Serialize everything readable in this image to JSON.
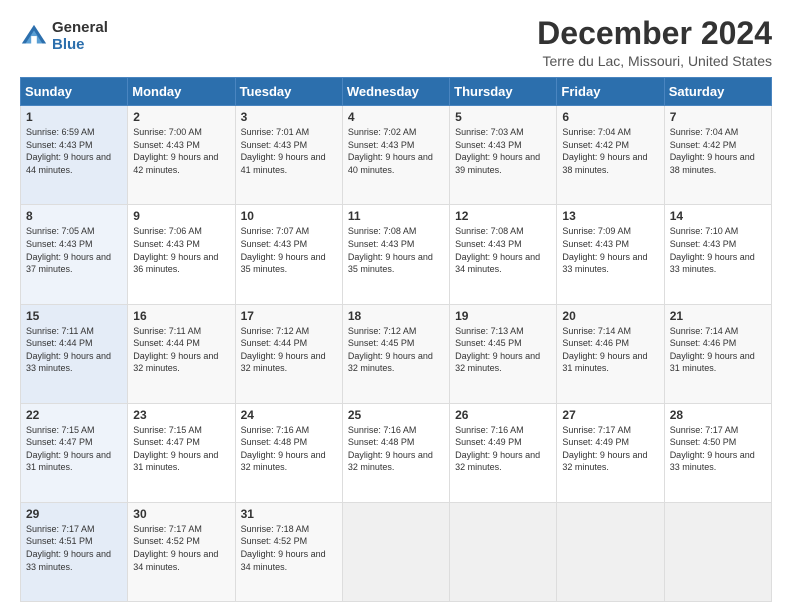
{
  "header": {
    "logo_general": "General",
    "logo_blue": "Blue",
    "title": "December 2024",
    "subtitle": "Terre du Lac, Missouri, United States"
  },
  "days_of_week": [
    "Sunday",
    "Monday",
    "Tuesday",
    "Wednesday",
    "Thursday",
    "Friday",
    "Saturday"
  ],
  "weeks": [
    [
      {
        "day": "1",
        "sunrise": "6:59 AM",
        "sunset": "4:43 PM",
        "daylight": "9 hours and 44 minutes."
      },
      {
        "day": "2",
        "sunrise": "7:00 AM",
        "sunset": "4:43 PM",
        "daylight": "9 hours and 42 minutes."
      },
      {
        "day": "3",
        "sunrise": "7:01 AM",
        "sunset": "4:43 PM",
        "daylight": "9 hours and 41 minutes."
      },
      {
        "day": "4",
        "sunrise": "7:02 AM",
        "sunset": "4:43 PM",
        "daylight": "9 hours and 40 minutes."
      },
      {
        "day": "5",
        "sunrise": "7:03 AM",
        "sunset": "4:43 PM",
        "daylight": "9 hours and 39 minutes."
      },
      {
        "day": "6",
        "sunrise": "7:04 AM",
        "sunset": "4:42 PM",
        "daylight": "9 hours and 38 minutes."
      },
      {
        "day": "7",
        "sunrise": "7:04 AM",
        "sunset": "4:42 PM",
        "daylight": "9 hours and 38 minutes."
      }
    ],
    [
      {
        "day": "8",
        "sunrise": "7:05 AM",
        "sunset": "4:43 PM",
        "daylight": "9 hours and 37 minutes."
      },
      {
        "day": "9",
        "sunrise": "7:06 AM",
        "sunset": "4:43 PM",
        "daylight": "9 hours and 36 minutes."
      },
      {
        "day": "10",
        "sunrise": "7:07 AM",
        "sunset": "4:43 PM",
        "daylight": "9 hours and 35 minutes."
      },
      {
        "day": "11",
        "sunrise": "7:08 AM",
        "sunset": "4:43 PM",
        "daylight": "9 hours and 35 minutes."
      },
      {
        "day": "12",
        "sunrise": "7:08 AM",
        "sunset": "4:43 PM",
        "daylight": "9 hours and 34 minutes."
      },
      {
        "day": "13",
        "sunrise": "7:09 AM",
        "sunset": "4:43 PM",
        "daylight": "9 hours and 33 minutes."
      },
      {
        "day": "14",
        "sunrise": "7:10 AM",
        "sunset": "4:43 PM",
        "daylight": "9 hours and 33 minutes."
      }
    ],
    [
      {
        "day": "15",
        "sunrise": "7:11 AM",
        "sunset": "4:44 PM",
        "daylight": "9 hours and 33 minutes."
      },
      {
        "day": "16",
        "sunrise": "7:11 AM",
        "sunset": "4:44 PM",
        "daylight": "9 hours and 32 minutes."
      },
      {
        "day": "17",
        "sunrise": "7:12 AM",
        "sunset": "4:44 PM",
        "daylight": "9 hours and 32 minutes."
      },
      {
        "day": "18",
        "sunrise": "7:12 AM",
        "sunset": "4:45 PM",
        "daylight": "9 hours and 32 minutes."
      },
      {
        "day": "19",
        "sunrise": "7:13 AM",
        "sunset": "4:45 PM",
        "daylight": "9 hours and 32 minutes."
      },
      {
        "day": "20",
        "sunrise": "7:14 AM",
        "sunset": "4:46 PM",
        "daylight": "9 hours and 31 minutes."
      },
      {
        "day": "21",
        "sunrise": "7:14 AM",
        "sunset": "4:46 PM",
        "daylight": "9 hours and 31 minutes."
      }
    ],
    [
      {
        "day": "22",
        "sunrise": "7:15 AM",
        "sunset": "4:47 PM",
        "daylight": "9 hours and 31 minutes."
      },
      {
        "day": "23",
        "sunrise": "7:15 AM",
        "sunset": "4:47 PM",
        "daylight": "9 hours and 31 minutes."
      },
      {
        "day": "24",
        "sunrise": "7:16 AM",
        "sunset": "4:48 PM",
        "daylight": "9 hours and 32 minutes."
      },
      {
        "day": "25",
        "sunrise": "7:16 AM",
        "sunset": "4:48 PM",
        "daylight": "9 hours and 32 minutes."
      },
      {
        "day": "26",
        "sunrise": "7:16 AM",
        "sunset": "4:49 PM",
        "daylight": "9 hours and 32 minutes."
      },
      {
        "day": "27",
        "sunrise": "7:17 AM",
        "sunset": "4:49 PM",
        "daylight": "9 hours and 32 minutes."
      },
      {
        "day": "28",
        "sunrise": "7:17 AM",
        "sunset": "4:50 PM",
        "daylight": "9 hours and 33 minutes."
      }
    ],
    [
      {
        "day": "29",
        "sunrise": "7:17 AM",
        "sunset": "4:51 PM",
        "daylight": "9 hours and 33 minutes."
      },
      {
        "day": "30",
        "sunrise": "7:17 AM",
        "sunset": "4:52 PM",
        "daylight": "9 hours and 34 minutes."
      },
      {
        "day": "31",
        "sunrise": "7:18 AM",
        "sunset": "4:52 PM",
        "daylight": "9 hours and 34 minutes."
      },
      null,
      null,
      null,
      null
    ]
  ]
}
